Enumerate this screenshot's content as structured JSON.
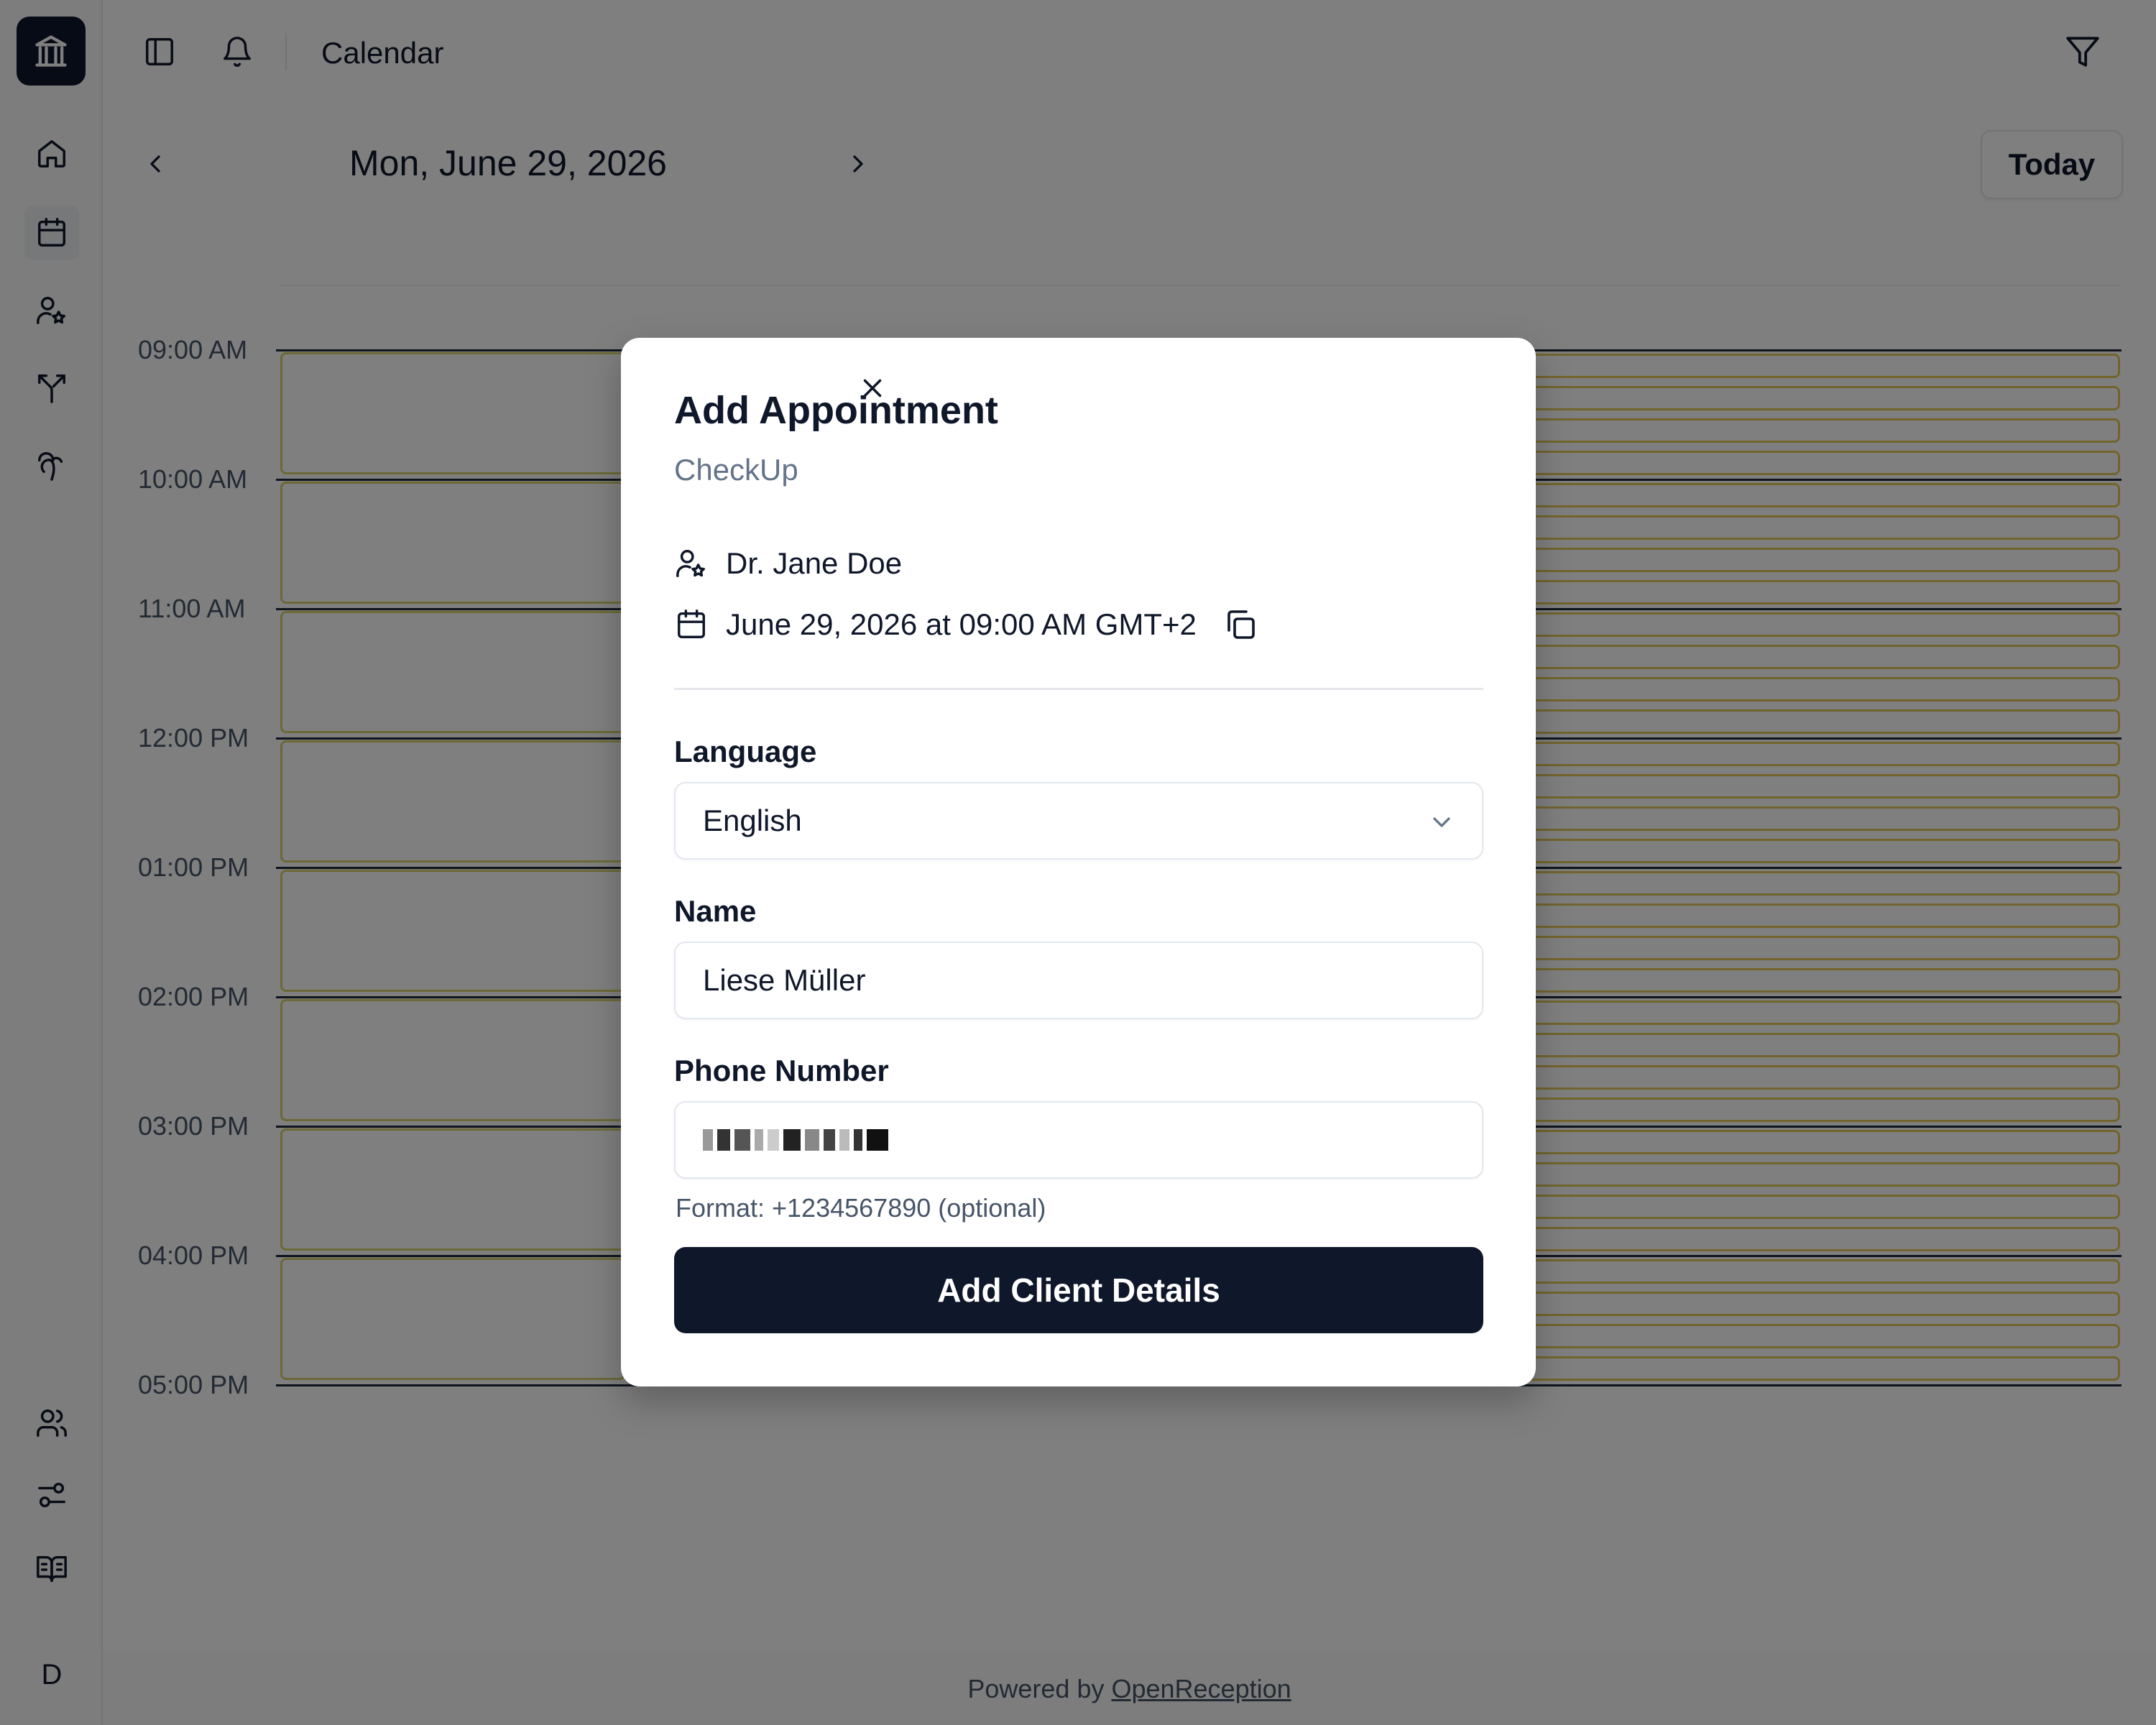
{
  "app": {
    "title": "Calendar",
    "footer_prefix": "Powered by",
    "footer_link": "OpenReception"
  },
  "sidebar": {
    "items": [
      {
        "icon": "home-icon"
      },
      {
        "icon": "calendar-icon",
        "active": true
      },
      {
        "icon": "user-star-icon"
      },
      {
        "icon": "split-icon"
      },
      {
        "icon": "palm-tree-icon"
      },
      {
        "icon": "users-icon"
      },
      {
        "icon": "sliders-icon"
      },
      {
        "icon": "book-icon"
      }
    ],
    "avatar_initial": "D"
  },
  "header": {
    "icons": [
      "sidebar-toggle-icon",
      "bell-icon",
      "filter-icon"
    ]
  },
  "date_nav": {
    "date_label": "Mon, June 29, 2026",
    "today_label": "Today"
  },
  "timeline": {
    "hours": [
      "09:00 AM",
      "10:00 AM",
      "11:00 AM",
      "12:00 PM",
      "01:00 PM",
      "02:00 PM",
      "03:00 PM",
      "04:00 PM",
      "05:00 PM"
    ]
  },
  "modal": {
    "title": "Add Appointment",
    "subtitle": "CheckUp",
    "doctor": "Dr. Jane Doe",
    "datetime": "June 29, 2026 at 09:00 AM GMT+2",
    "language_label": "Language",
    "language_value": "English",
    "name_label": "Name",
    "name_value": "Liese Müller",
    "phone_label": "Phone Number",
    "phone_hint": "Format: +1234567890 (optional)",
    "submit_label": "Add Client Details"
  },
  "colors": {
    "primary": "#0f172a",
    "muted": "#64748b",
    "slot_border": "#d9d36e"
  }
}
